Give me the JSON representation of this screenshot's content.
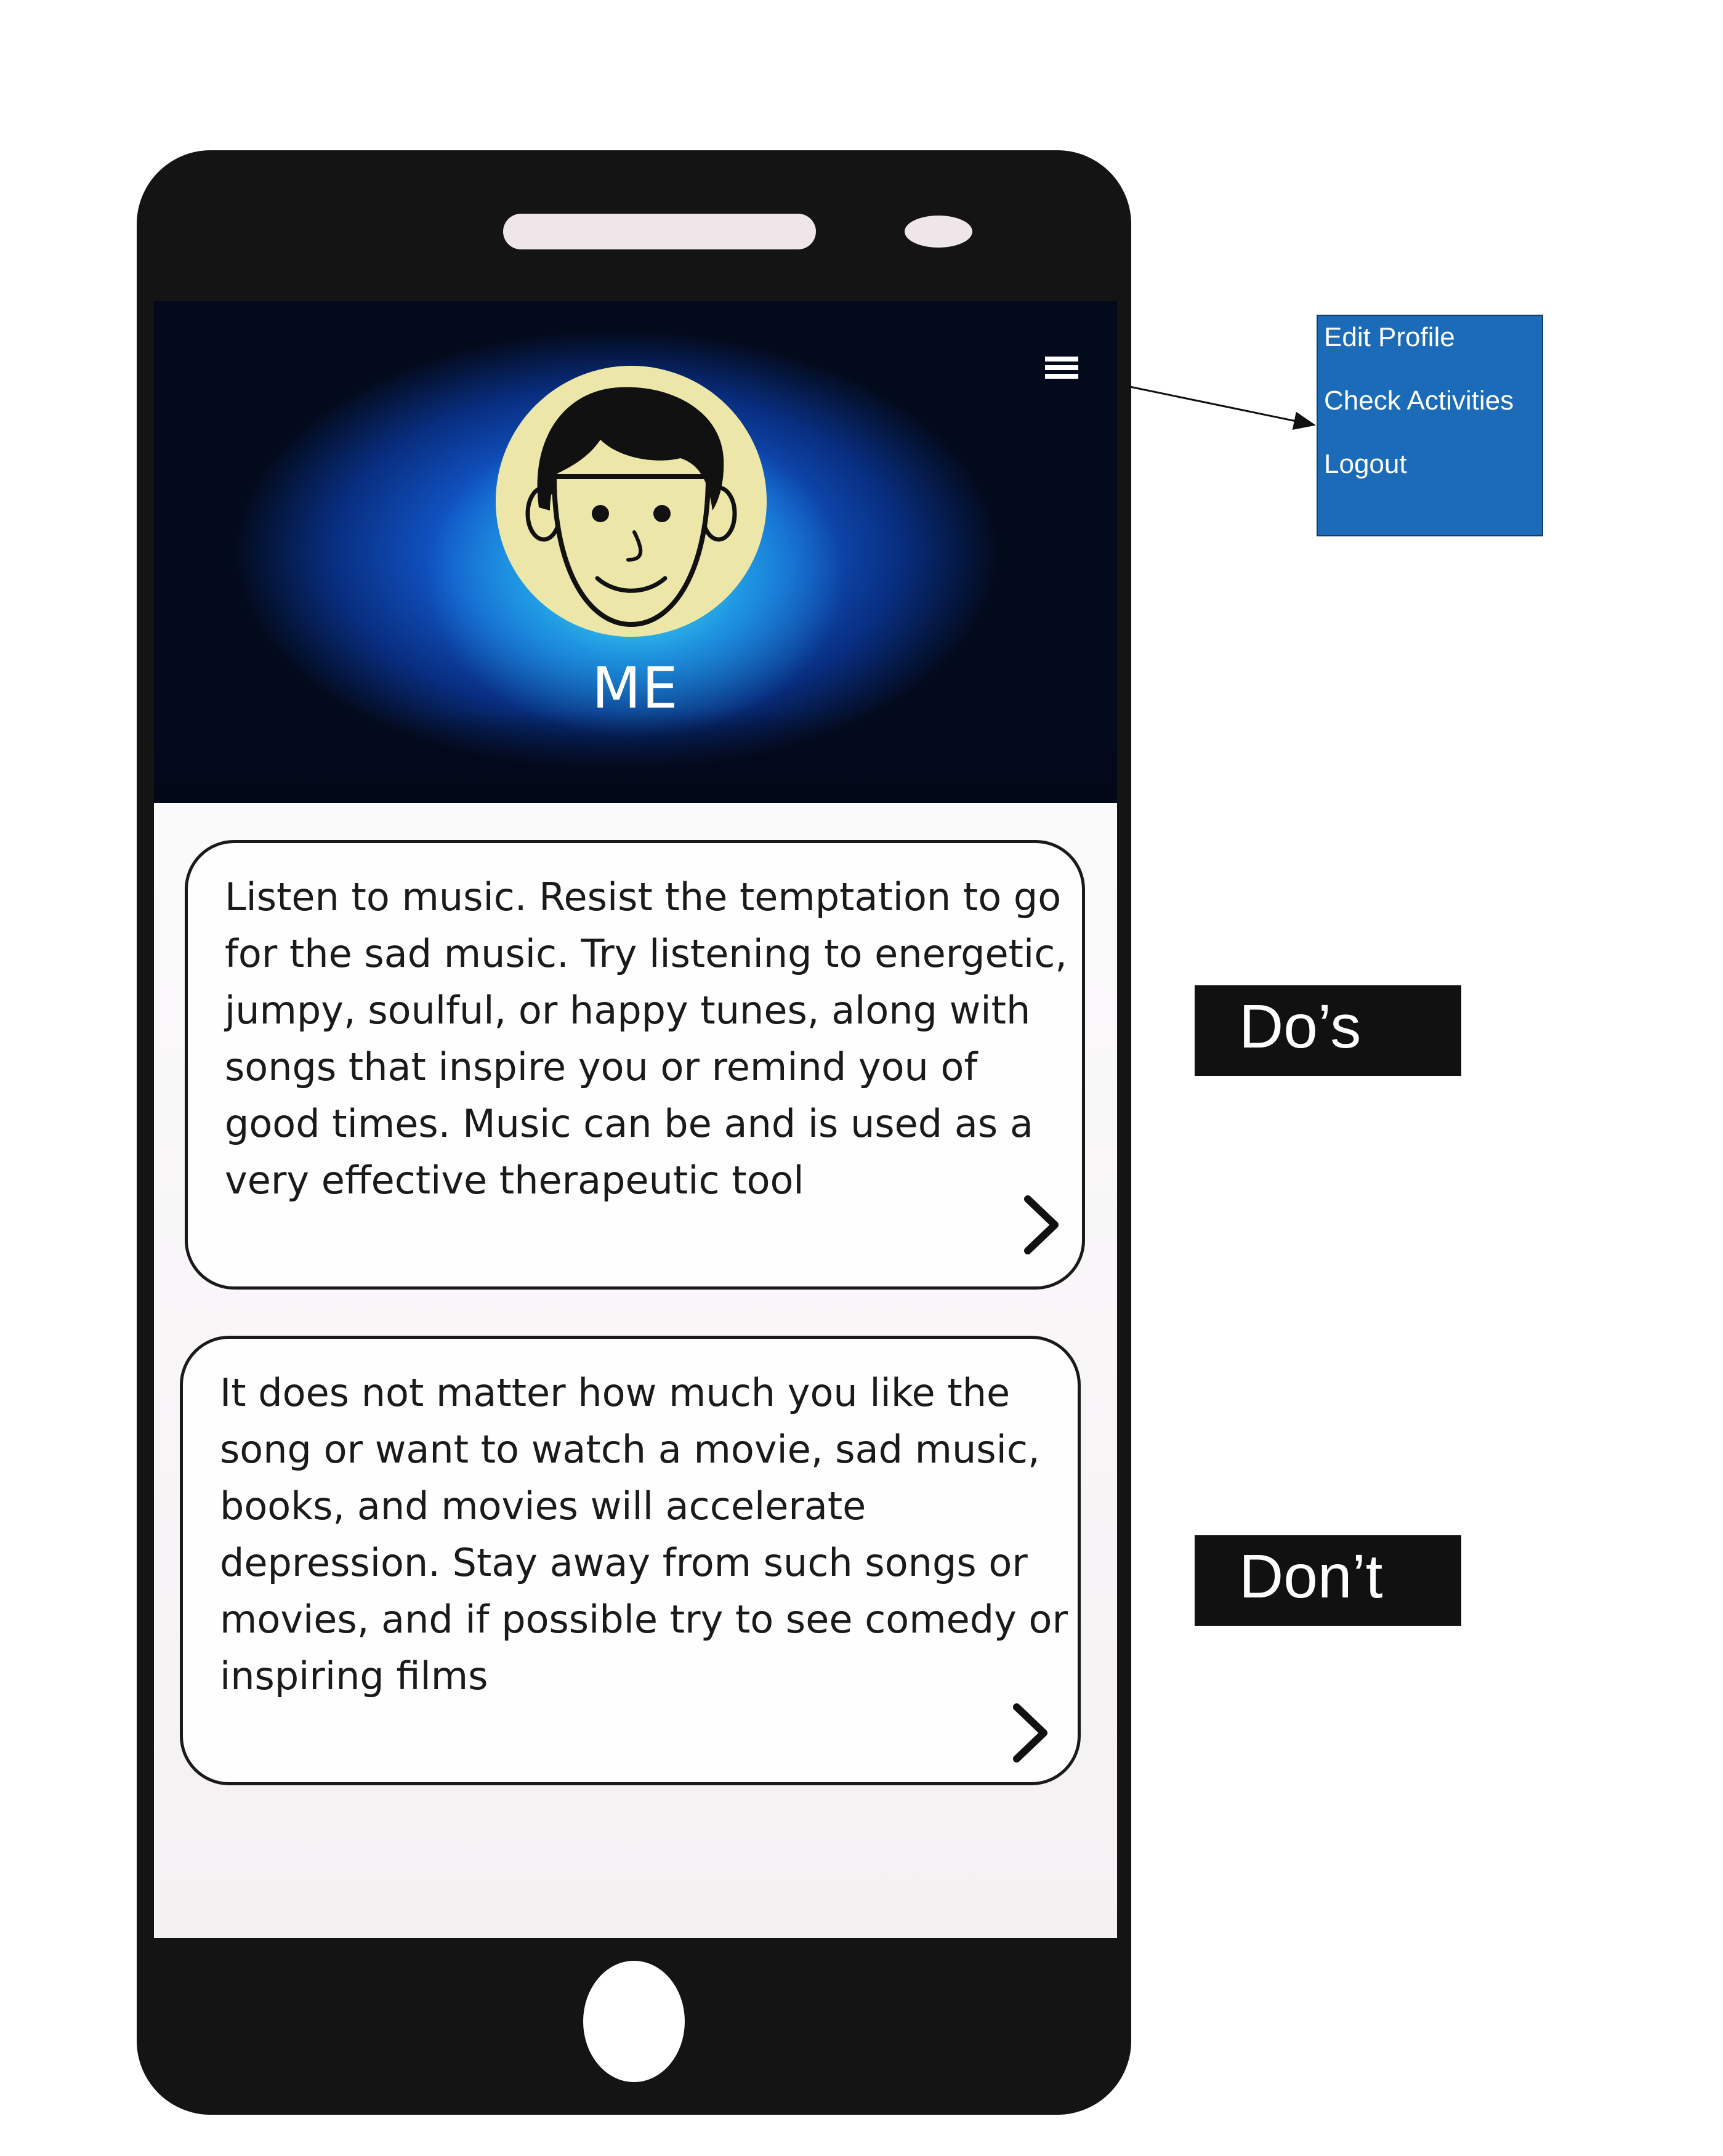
{
  "profile": {
    "name": "ME",
    "avatar_icon": "cartoon-face-avatar",
    "menu_icon": "hamburger-menu-icon"
  },
  "cards": [
    {
      "text": "Listen to music. Resist the temptation to go for the sad music. Try listening to energetic, jumpy, soulful, or happy tunes, along with songs that inspire you or remind you of good times. Music can be and is used as a very effective therapeutic tool",
      "icon": "chevron-right-icon"
    },
    {
      "text": "It does not matter how much you like the song or want to watch a movie, sad music, books, and movies will accelerate depression. Stay away from such songs or movies, and if possible try to see comedy or inspiring films",
      "icon": "chevron-right-icon"
    }
  ],
  "menu": {
    "items": [
      {
        "label": "Edit Profile"
      },
      {
        "label": "Check Activities"
      },
      {
        "label": "Logout"
      }
    ]
  },
  "annotations": {
    "dos_label": "Do’s",
    "dont_label": "Don’t"
  },
  "colors": {
    "phone_body": "#141414",
    "menu_background": "#1b6bb8",
    "avatar_background": "#ece7a8",
    "tag_background": "#111111"
  }
}
